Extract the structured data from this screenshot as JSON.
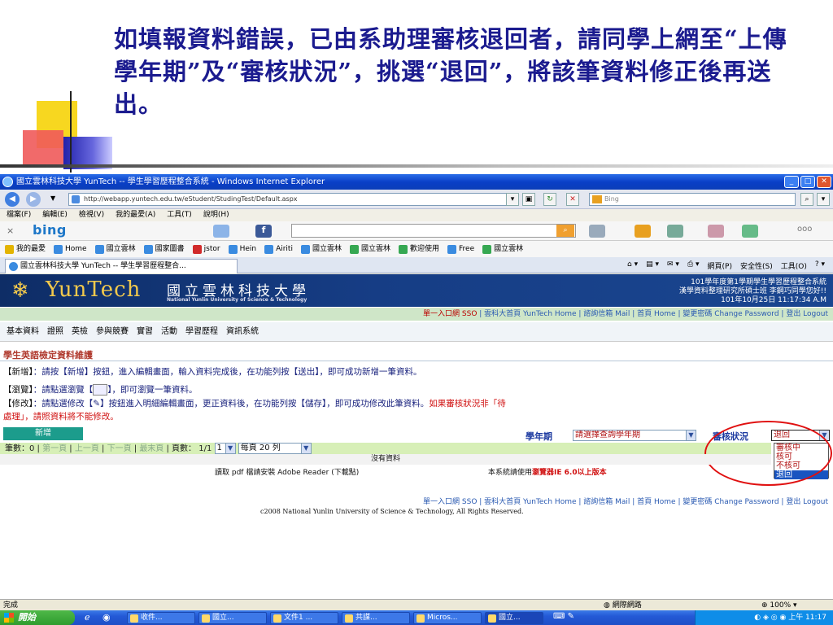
{
  "slide": {
    "text": "如填報資料錯誤，已由系助理審核退回者，請同學上網至“上傳學年期”及“審核狀況”，挑選“退回”，將該筆資料修正後再送出。"
  },
  "window": {
    "title": "國立雲林科技大學 YunTech -- 學生學習歷程整合系統 - Windows Internet Explorer",
    "url": "http://webapp.yuntech.edu.tw/eStudent/StudingTest/Default.aspx",
    "search_placeholder": "Bing",
    "menu": [
      "檔案(F)",
      "編輯(E)",
      "檢視(V)",
      "我的最愛(A)",
      "工具(T)",
      "說明(H)"
    ],
    "bing_logo": "bing",
    "favorites": [
      "我的最愛",
      "Home",
      "國立雲林",
      "國家圖書",
      "jstor",
      "Hein",
      "Airiti",
      "國立雲林",
      "國立雲林",
      "歡迎使用",
      "Free",
      "國立雲林"
    ],
    "tab_title": "國立雲林科技大學 YunTech -- 學生學習歷程整合...",
    "command_bar": [
      "網頁(P)",
      "安全性(S)",
      "工具(O)"
    ],
    "status_left": "完成",
    "status_zone": "網際網路",
    "status_zoom": "100%"
  },
  "page": {
    "logo": "YunTech",
    "school_name": "國立雲林科技大學",
    "school_name_en": "National Yunlin University of Science & Technology",
    "header_right": [
      "101學年度第1學期學生學習歷程整合系統",
      "漢學資料整理研究所碩士班 李鋼巧同學您好!!",
      "101年10月25日 11:17:34 A.M"
    ],
    "top_links_prefix": "單一入口網 SSO",
    "top_links": "| 雲科大首頁 YunTech Home | 諮詢信箱 Mail | 首頁 Home | 變更密碼 Change Password | 登出 Logout",
    "nav": [
      "基本資料",
      "證照",
      "英檢",
      "參與競賽",
      "實習",
      "活動",
      "學習歷程",
      "資訊系統"
    ],
    "section_title": "學生英語檢定資料維護",
    "inst_add_label": "【新增】",
    "inst_add_text": "：請按【新增】按鈕，進入編輯畫面，輸入資料完成後，在功能列按【送出】，即可成功新增一筆資料。",
    "inst_view_label": "【瀏覽】",
    "inst_view_text": "：請點選瀏覽【",
    "inst_view_text2": "】，即可瀏覽一筆資料。",
    "inst_edit_label": "【修改】",
    "inst_edit_text": "：請點選修改【",
    "inst_edit_text2": "】按鈕進入明細編輯畫面，更正資料後，在功能列按【儲存】，即可成功修改此筆資料。",
    "inst_edit_red": "如果審核狀況非「待",
    "inst_edit_red2": "處理」，請照資料將不能修改。",
    "add_button": "新增",
    "term_label": "學年期",
    "term_value": "請選擇查詢學年期",
    "status_label": "審核狀況",
    "status_value": "退回",
    "status_options": [
      "審核中",
      "核可",
      "不核可",
      "退回"
    ],
    "pager": {
      "count": "筆數：0 |",
      "first": "第一頁",
      "prev": "上一頁",
      "next": "下一頁",
      "last": "最末頁",
      "pages": "| 頁數： 1/1",
      "page_value": "1",
      "per_page": "每頁 20 列"
    },
    "no_data": "沒有資料",
    "pdf_note": "讀取 pdf 檔請安裝 Adobe Reader (下載點)",
    "browser_note": "本系統請使用",
    "browser_note_red": "瀏覽器IE 6.0以上版本",
    "footer_links": "單一入口網 SSO | 雲科大首頁 YunTech Home | 諮詢信箱 Mail | 首頁 Home | 變更密碼 Change Password | 登出 Logout",
    "copyright": "c2008 National Yunlin University of Science & Technology, All Rights Reserved."
  },
  "taskbar": {
    "start": "開始",
    "tasks": [
      "收件...",
      "國立...",
      "文件1 ...",
      "共謀...",
      "Micros...",
      "國立..."
    ],
    "clock": "上午 11:17"
  }
}
